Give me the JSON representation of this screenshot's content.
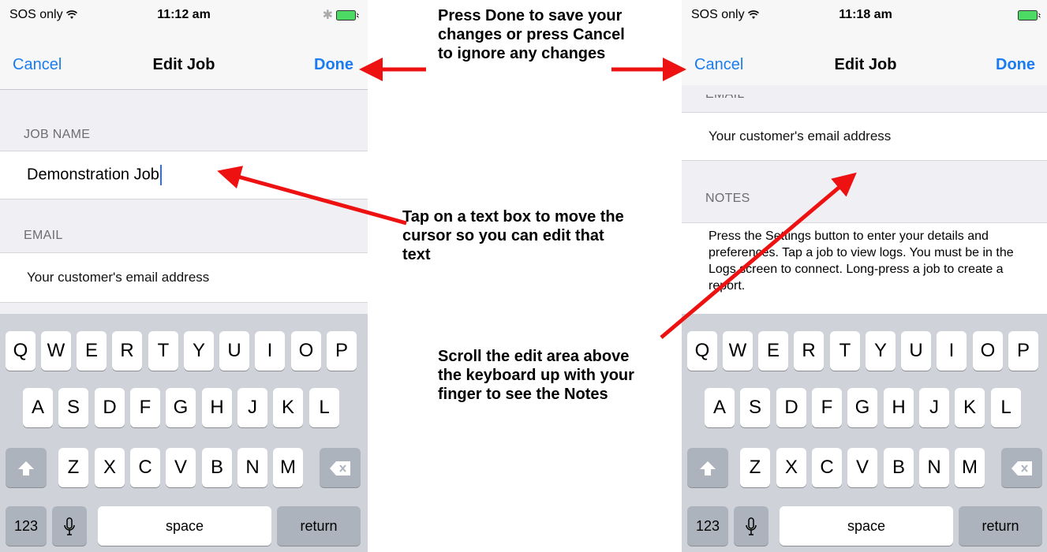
{
  "left_phone": {
    "status": {
      "carrier": "SOS only",
      "time": "11:12 am"
    },
    "nav": {
      "cancel": "Cancel",
      "title": "Edit Job",
      "done": "Done"
    },
    "job_name_label": "JOB NAME",
    "job_name_value": "Demonstration Job",
    "email_label": "EMAIL",
    "email_placeholder": "Your customer's email address"
  },
  "right_phone": {
    "status": {
      "carrier": "SOS only",
      "time": "11:18 am"
    },
    "nav": {
      "cancel": "Cancel",
      "title": "Edit Job",
      "done": "Done"
    },
    "email_label": "EMAIL",
    "email_placeholder": "Your customer's email address",
    "notes_label": "NOTES",
    "notes_text": "Press the Settings button to enter your details and preferences. Tap a job to view logs. You must be in the Logs screen to connect. Long-press a job to create a report."
  },
  "keyboard": {
    "row1": [
      "Q",
      "W",
      "E",
      "R",
      "T",
      "Y",
      "U",
      "I",
      "O",
      "P"
    ],
    "row2": [
      "A",
      "S",
      "D",
      "F",
      "G",
      "H",
      "J",
      "K",
      "L"
    ],
    "row3": [
      "Z",
      "X",
      "C",
      "V",
      "B",
      "N",
      "M"
    ],
    "numbers_key": "123",
    "space_key": "space",
    "return_key": "return"
  },
  "annotations": {
    "done_cancel": "Press Done to save your changes or press Cancel to ignore any changes",
    "tap_text_box": "Tap on a text box to move the cursor so you can edit that text",
    "scroll_edit": "Scroll the edit area above the keyboard up with your finger to see the Notes"
  },
  "colors": {
    "ios_blue": "#1a7cf0",
    "arrow_red": "#ee1111",
    "keyboard_bg": "#cfd3d9"
  }
}
